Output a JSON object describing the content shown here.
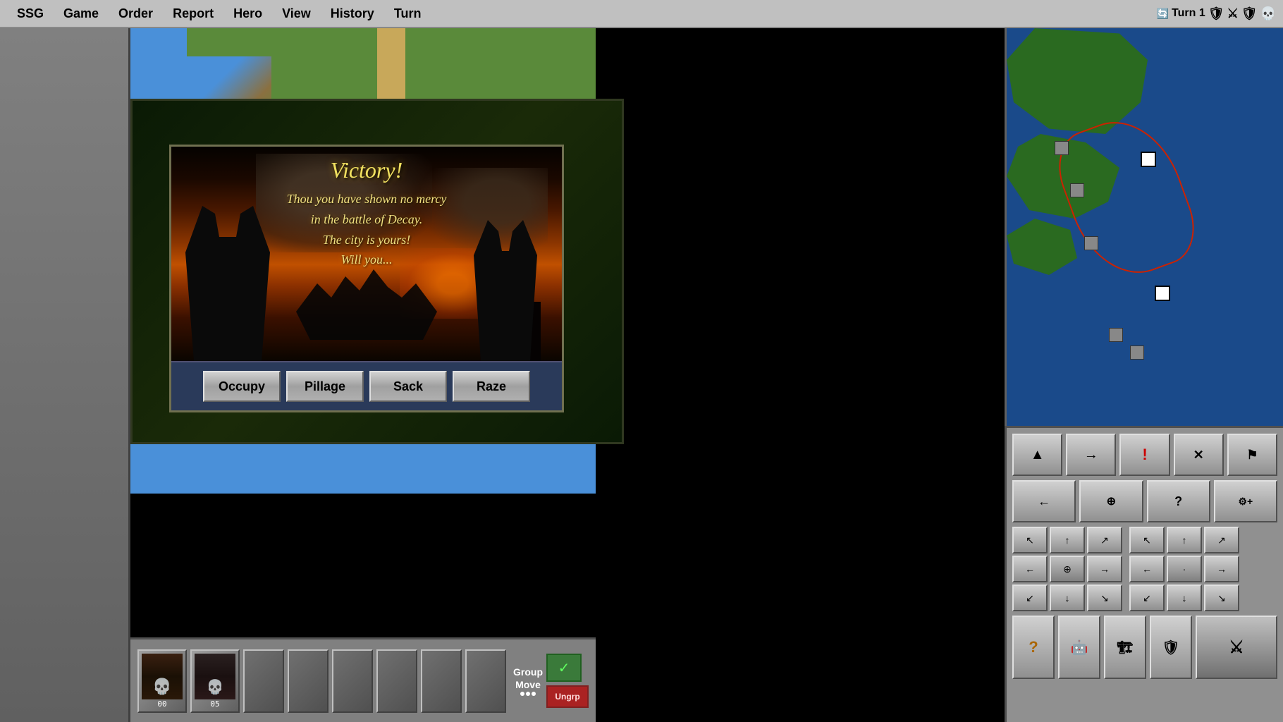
{
  "menubar": {
    "items": [
      "SSG",
      "Game",
      "Order",
      "Report",
      "Hero",
      "View",
      "History",
      "Turn"
    ],
    "turn_label": "Turn 1"
  },
  "victory": {
    "title": "Victory!",
    "message_line1": "Thou you have shown no mercy",
    "message_line2": "in the battle of Decay.",
    "message_line3": "The city is yours!",
    "message_line4": "Will you...",
    "buttons": [
      "Occupy",
      "Pillage",
      "Sack",
      "Raze"
    ]
  },
  "units": {
    "slots": [
      {
        "id": 1,
        "label": "00",
        "has_unit": true,
        "portrait_color": "#3a2010"
      },
      {
        "id": 2,
        "label": "05",
        "has_unit": true,
        "portrait_color": "#2a2020"
      },
      {
        "id": 3,
        "label": "",
        "has_unit": false
      },
      {
        "id": 4,
        "label": "",
        "has_unit": false
      },
      {
        "id": 5,
        "label": "",
        "has_unit": false
      },
      {
        "id": 6,
        "label": "",
        "has_unit": false
      },
      {
        "id": 7,
        "label": "",
        "has_unit": false
      },
      {
        "id": 8,
        "label": "",
        "has_unit": false
      }
    ],
    "group_label": "Group",
    "move_label": "Move",
    "ungrp_label": "Ungrp"
  },
  "controls": {
    "arrow_buttons": [
      "↖",
      "↑",
      "↗",
      "←",
      "⊕",
      "→",
      "↙",
      "↓",
      "↘"
    ],
    "action_buttons": [
      {
        "icon": "▲",
        "name": "move-up"
      },
      {
        "icon": "→",
        "name": "move-right"
      },
      {
        "icon": "!",
        "name": "alert"
      },
      {
        "icon": "✕",
        "name": "cancel"
      },
      {
        "icon": "⚑",
        "name": "flag"
      },
      {
        "icon": "⚙",
        "name": "group-move"
      },
      {
        "icon": "?",
        "name": "query"
      },
      {
        "icon": "⚙",
        "name": "split"
      },
      {
        "icon": "?",
        "name": "help"
      },
      {
        "icon": "🤖",
        "name": "unit-info"
      },
      {
        "icon": "⚙",
        "name": "terrain"
      },
      {
        "icon": "⚑",
        "name": "defend"
      },
      {
        "icon": "⚔",
        "name": "combat"
      }
    ]
  }
}
